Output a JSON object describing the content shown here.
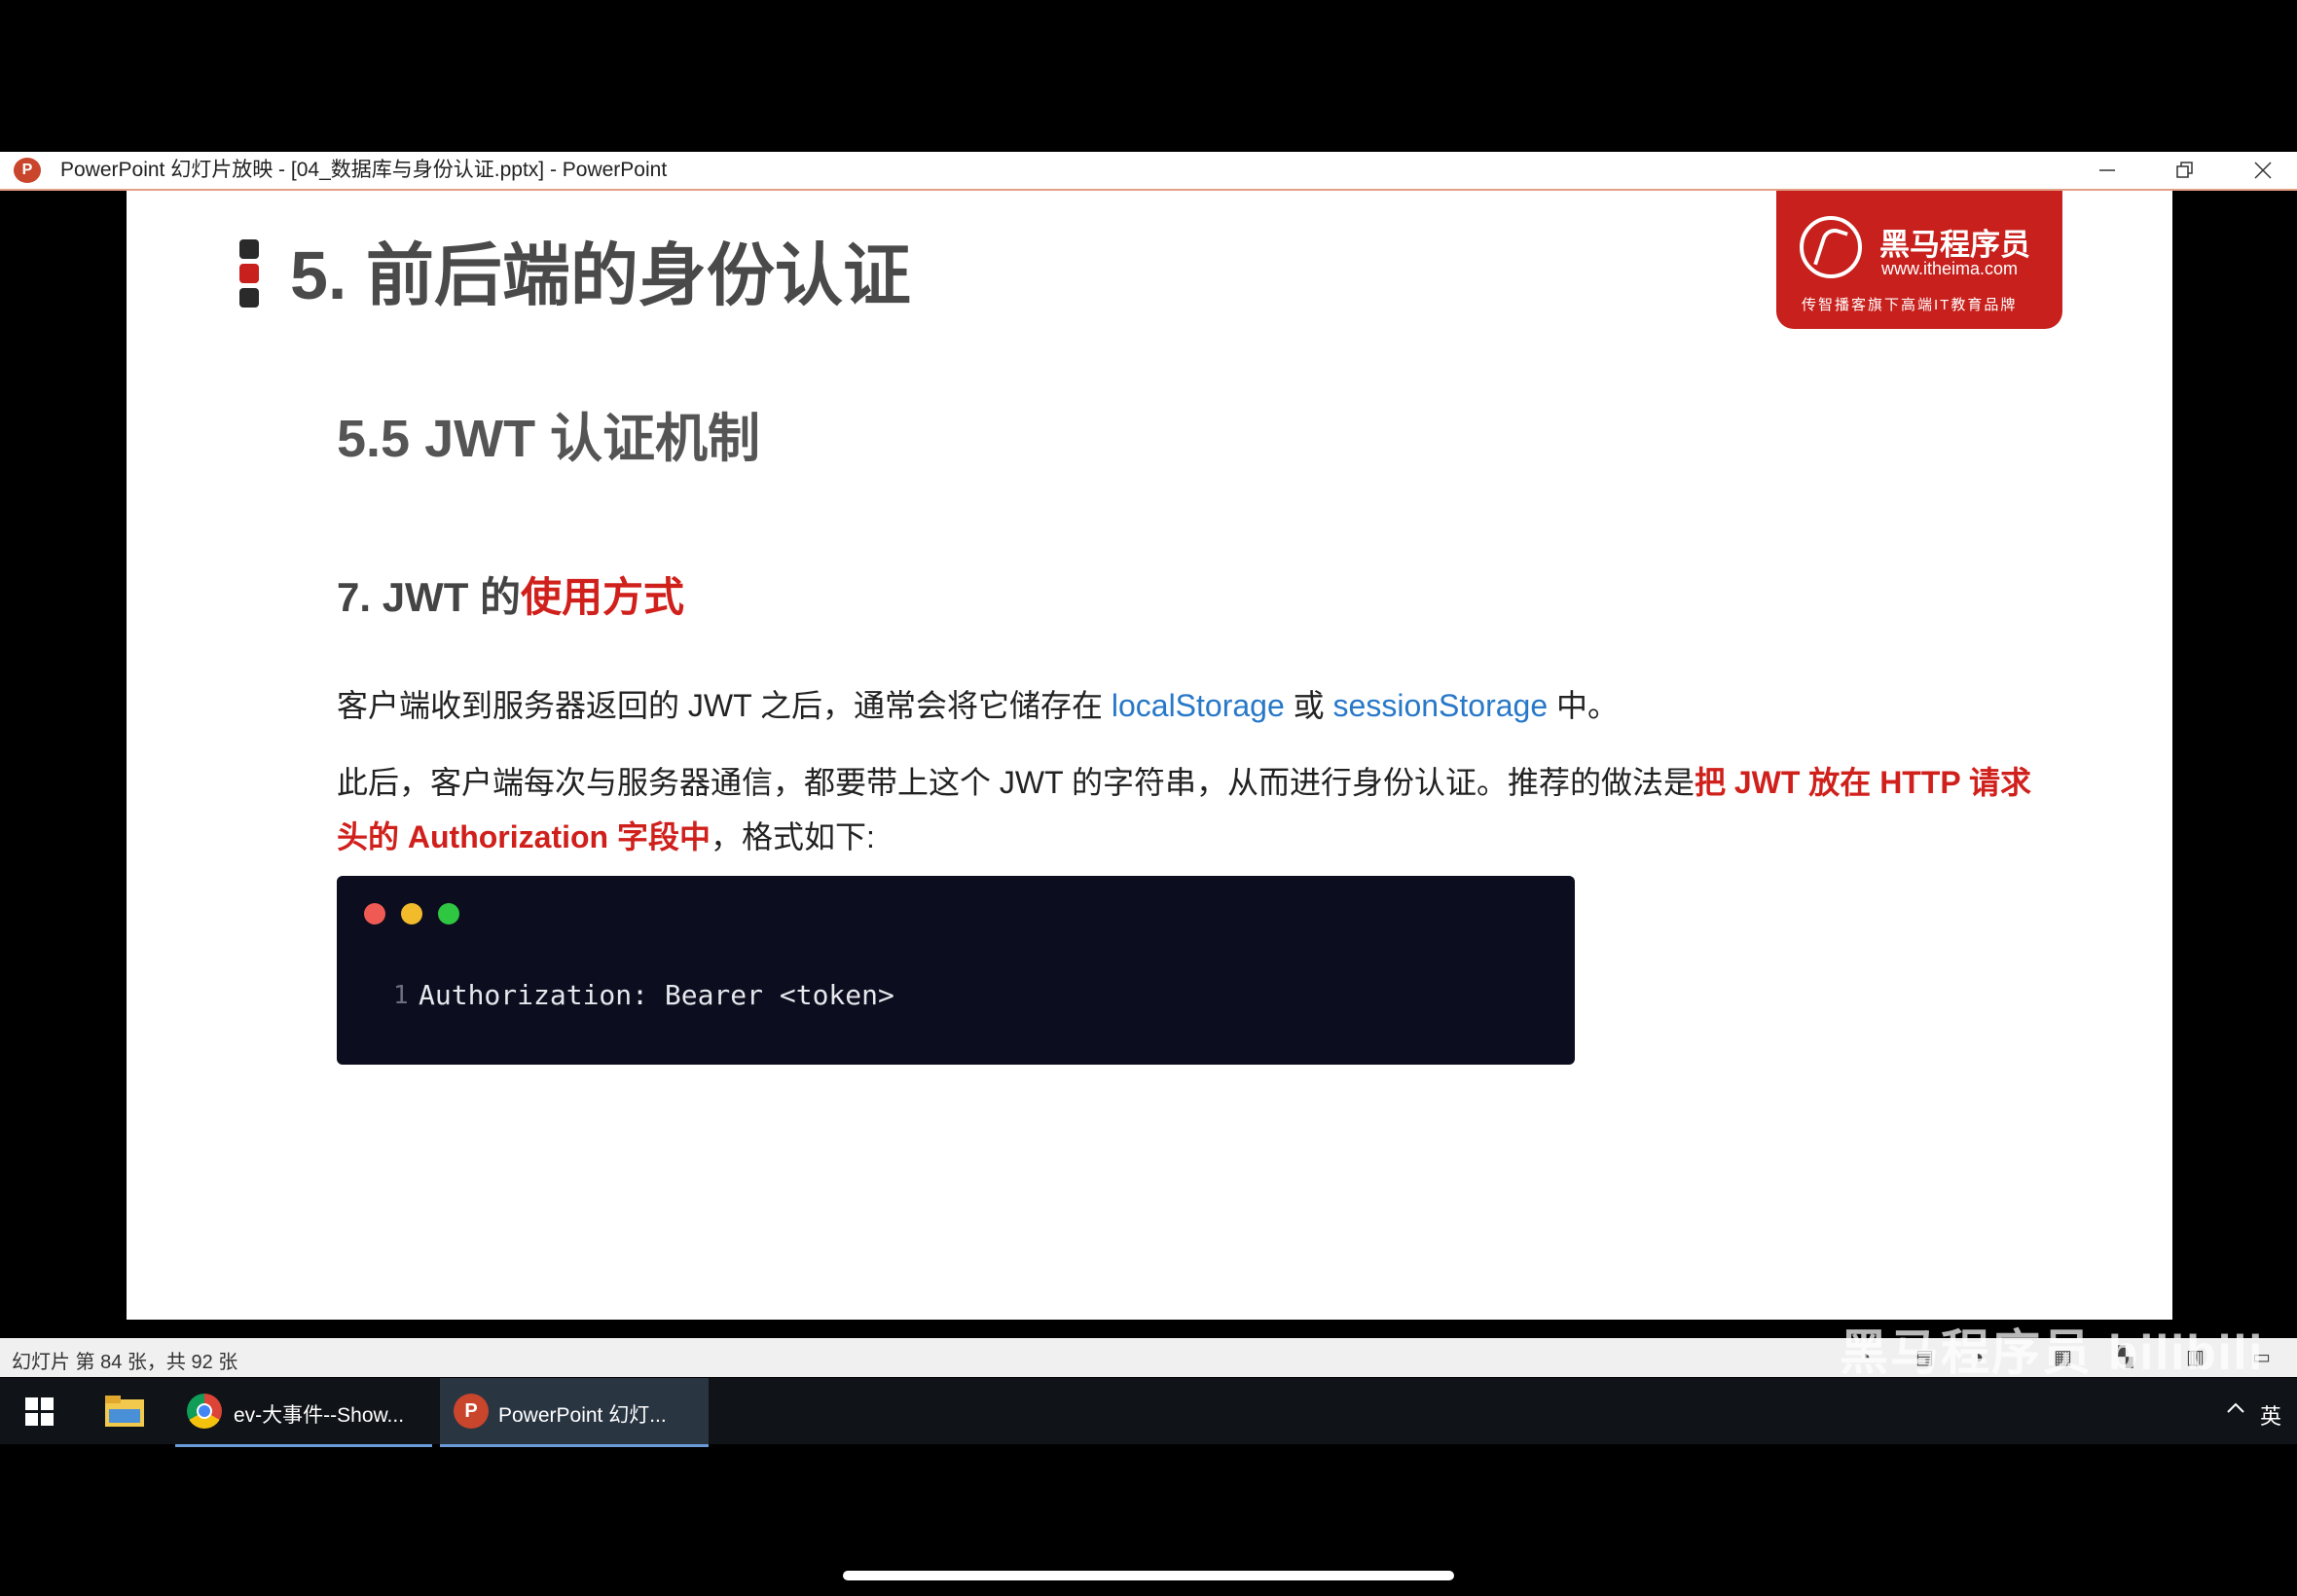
{
  "window": {
    "app_icon_letter": "P",
    "title": "PowerPoint 幻灯片放映 - [04_数据库与身份认证.pptx] - PowerPoint"
  },
  "slide": {
    "title": "5. 前后端的身份认证",
    "logo": {
      "brand": "黑马程序员",
      "url": "www.itheima.com",
      "slogan": "传智播客旗下高端IT教育品牌"
    },
    "subtitle": "5.5 JWT 认证机制",
    "point": {
      "prefix": "7. JWT 的",
      "highlight": "使用方式"
    },
    "para1": {
      "text_a": "客户端收到服务器返回的 JWT 之后，通常会将它储存在 ",
      "storage_a": "localStorage",
      "text_b": " 或 ",
      "storage_b": "sessionStorage",
      "text_c": " 中。"
    },
    "para2": {
      "text_a": "此后，客户端每次与服务器通信，都要带上这个 JWT 的字符串，从而进行身份认证。推荐的做法是",
      "highlight": "把 JWT 放在 HTTP 请求头的 Authorization 字段中",
      "text_b": "，格式如下:"
    },
    "code": {
      "line_number": "1",
      "line": "Authorization: Bearer <token>"
    }
  },
  "statusbar": {
    "slide_count": "幻灯片 第 84 张，共 92 张",
    "watermark": "黑马程序员 bilibili"
  },
  "taskbar": {
    "items": [
      {
        "label": "ev-大事件--Show..."
      },
      {
        "label": "PowerPoint 幻灯..."
      }
    ],
    "ppt_icon_letter": "P",
    "input_language": "英"
  },
  "colors": {
    "accent_red": "#c8201c",
    "link_blue": "#2878c8",
    "code_bg": "#0c0d1e"
  }
}
